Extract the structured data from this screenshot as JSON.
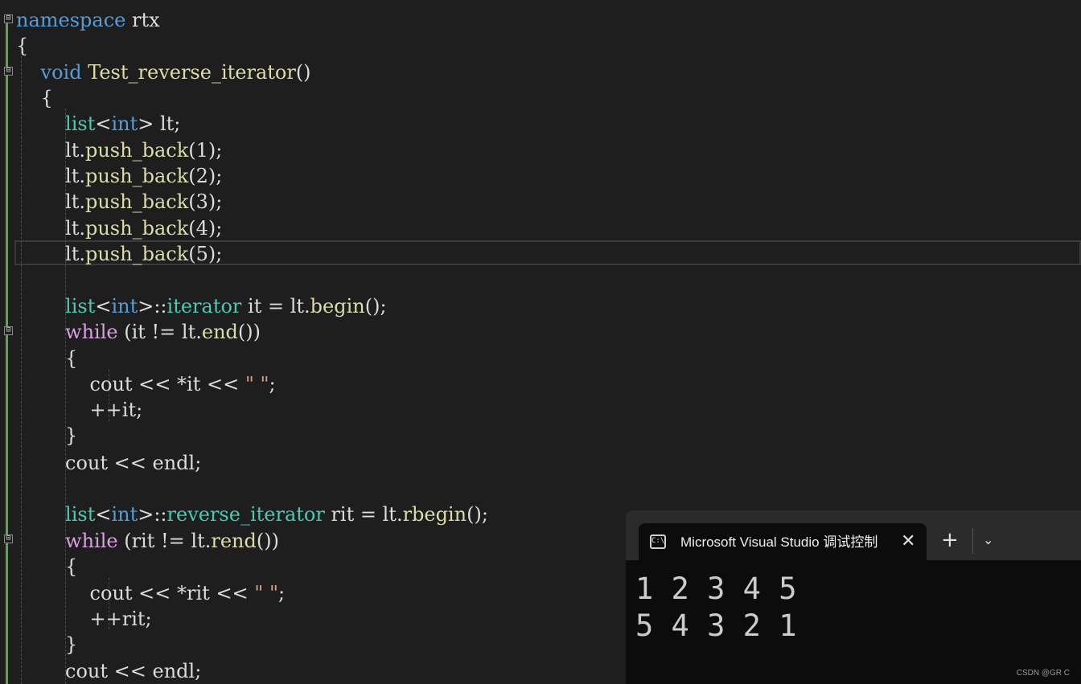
{
  "editor": {
    "lines": [
      {
        "tokens": [
          {
            "t": "namespace",
            "c": "kw"
          },
          {
            "t": " rtx",
            "c": ""
          }
        ]
      },
      {
        "tokens": [
          {
            "t": "{",
            "c": ""
          }
        ]
      },
      {
        "tokens": [
          {
            "t": "    ",
            "c": ""
          },
          {
            "t": "void",
            "c": "kw"
          },
          {
            "t": " ",
            "c": ""
          },
          {
            "t": "Test_reverse_iterator",
            "c": "fn"
          },
          {
            "t": "()",
            "c": ""
          }
        ]
      },
      {
        "tokens": [
          {
            "t": "    {",
            "c": ""
          }
        ]
      },
      {
        "tokens": [
          {
            "t": "        ",
            "c": ""
          },
          {
            "t": "list",
            "c": "ty"
          },
          {
            "t": "<",
            "c": ""
          },
          {
            "t": "int",
            "c": "kw"
          },
          {
            "t": "> lt;",
            "c": ""
          }
        ]
      },
      {
        "tokens": [
          {
            "t": "        lt.",
            "c": ""
          },
          {
            "t": "push_back",
            "c": "fn"
          },
          {
            "t": "(1);",
            "c": ""
          }
        ]
      },
      {
        "tokens": [
          {
            "t": "        lt.",
            "c": ""
          },
          {
            "t": "push_back",
            "c": "fn"
          },
          {
            "t": "(2);",
            "c": ""
          }
        ]
      },
      {
        "tokens": [
          {
            "t": "        lt.",
            "c": ""
          },
          {
            "t": "push_back",
            "c": "fn"
          },
          {
            "t": "(3);",
            "c": ""
          }
        ]
      },
      {
        "tokens": [
          {
            "t": "        lt.",
            "c": ""
          },
          {
            "t": "push_back",
            "c": "fn"
          },
          {
            "t": "(4);",
            "c": ""
          }
        ]
      },
      {
        "tokens": [
          {
            "t": "        lt.",
            "c": ""
          },
          {
            "t": "push_back",
            "c": "fn"
          },
          {
            "t": "(5);",
            "c": ""
          }
        ]
      },
      {
        "tokens": []
      },
      {
        "tokens": [
          {
            "t": "        ",
            "c": ""
          },
          {
            "t": "list",
            "c": "ty"
          },
          {
            "t": "<",
            "c": ""
          },
          {
            "t": "int",
            "c": "kw"
          },
          {
            "t": ">::",
            "c": ""
          },
          {
            "t": "iterator",
            "c": "ty"
          },
          {
            "t": " it = lt.",
            "c": ""
          },
          {
            "t": "begin",
            "c": "fn"
          },
          {
            "t": "();",
            "c": ""
          }
        ]
      },
      {
        "tokens": [
          {
            "t": "        ",
            "c": ""
          },
          {
            "t": "while",
            "c": "ct"
          },
          {
            "t": " (it != lt.",
            "c": ""
          },
          {
            "t": "end",
            "c": "fn"
          },
          {
            "t": "())",
            "c": ""
          }
        ]
      },
      {
        "tokens": [
          {
            "t": "        {",
            "c": ""
          }
        ]
      },
      {
        "tokens": [
          {
            "t": "            cout << *it << ",
            "c": ""
          },
          {
            "t": "\" \"",
            "c": "st"
          },
          {
            "t": ";",
            "c": ""
          }
        ]
      },
      {
        "tokens": [
          {
            "t": "            ++it;",
            "c": ""
          }
        ]
      },
      {
        "tokens": [
          {
            "t": "        }",
            "c": ""
          }
        ]
      },
      {
        "tokens": [
          {
            "t": "        cout << endl;",
            "c": ""
          }
        ]
      },
      {
        "tokens": []
      },
      {
        "tokens": [
          {
            "t": "        ",
            "c": ""
          },
          {
            "t": "list",
            "c": "ty"
          },
          {
            "t": "<",
            "c": ""
          },
          {
            "t": "int",
            "c": "kw"
          },
          {
            "t": ">::",
            "c": ""
          },
          {
            "t": "reverse_iterator",
            "c": "ty"
          },
          {
            "t": " rit = lt.",
            "c": ""
          },
          {
            "t": "rbegin",
            "c": "fn"
          },
          {
            "t": "();",
            "c": ""
          }
        ]
      },
      {
        "tokens": [
          {
            "t": "        ",
            "c": ""
          },
          {
            "t": "while",
            "c": "ct"
          },
          {
            "t": " (rit != lt.",
            "c": ""
          },
          {
            "t": "rend",
            "c": "fn"
          },
          {
            "t": "())",
            "c": ""
          }
        ]
      },
      {
        "tokens": [
          {
            "t": "        {",
            "c": ""
          }
        ]
      },
      {
        "tokens": [
          {
            "t": "            cout << *rit << ",
            "c": ""
          },
          {
            "t": "\" \"",
            "c": "st"
          },
          {
            "t": ";",
            "c": ""
          }
        ]
      },
      {
        "tokens": [
          {
            "t": "            ++rit;",
            "c": ""
          }
        ]
      },
      {
        "tokens": [
          {
            "t": "        }",
            "c": ""
          }
        ]
      },
      {
        "tokens": [
          {
            "t": "        cout << endl;",
            "c": ""
          }
        ]
      }
    ],
    "fold_marker": "⊟"
  },
  "terminal": {
    "tab_title": "Microsoft Visual Studio 调试控制台",
    "tab_icon_text": "C:\\",
    "close_glyph": "✕",
    "new_tab_glyph": "+",
    "dropdown_glyph": "⌄",
    "output": [
      "1 2 3 4 5",
      "5 4 3 2 1"
    ]
  },
  "watermark": "CSDN @GR C",
  "colors": {
    "keyword": "#569cd6",
    "type": "#4ec9b0",
    "function": "#dcdcaa",
    "control": "#d8a0df",
    "string": "#d69d85",
    "text": "#dcdcdc"
  }
}
